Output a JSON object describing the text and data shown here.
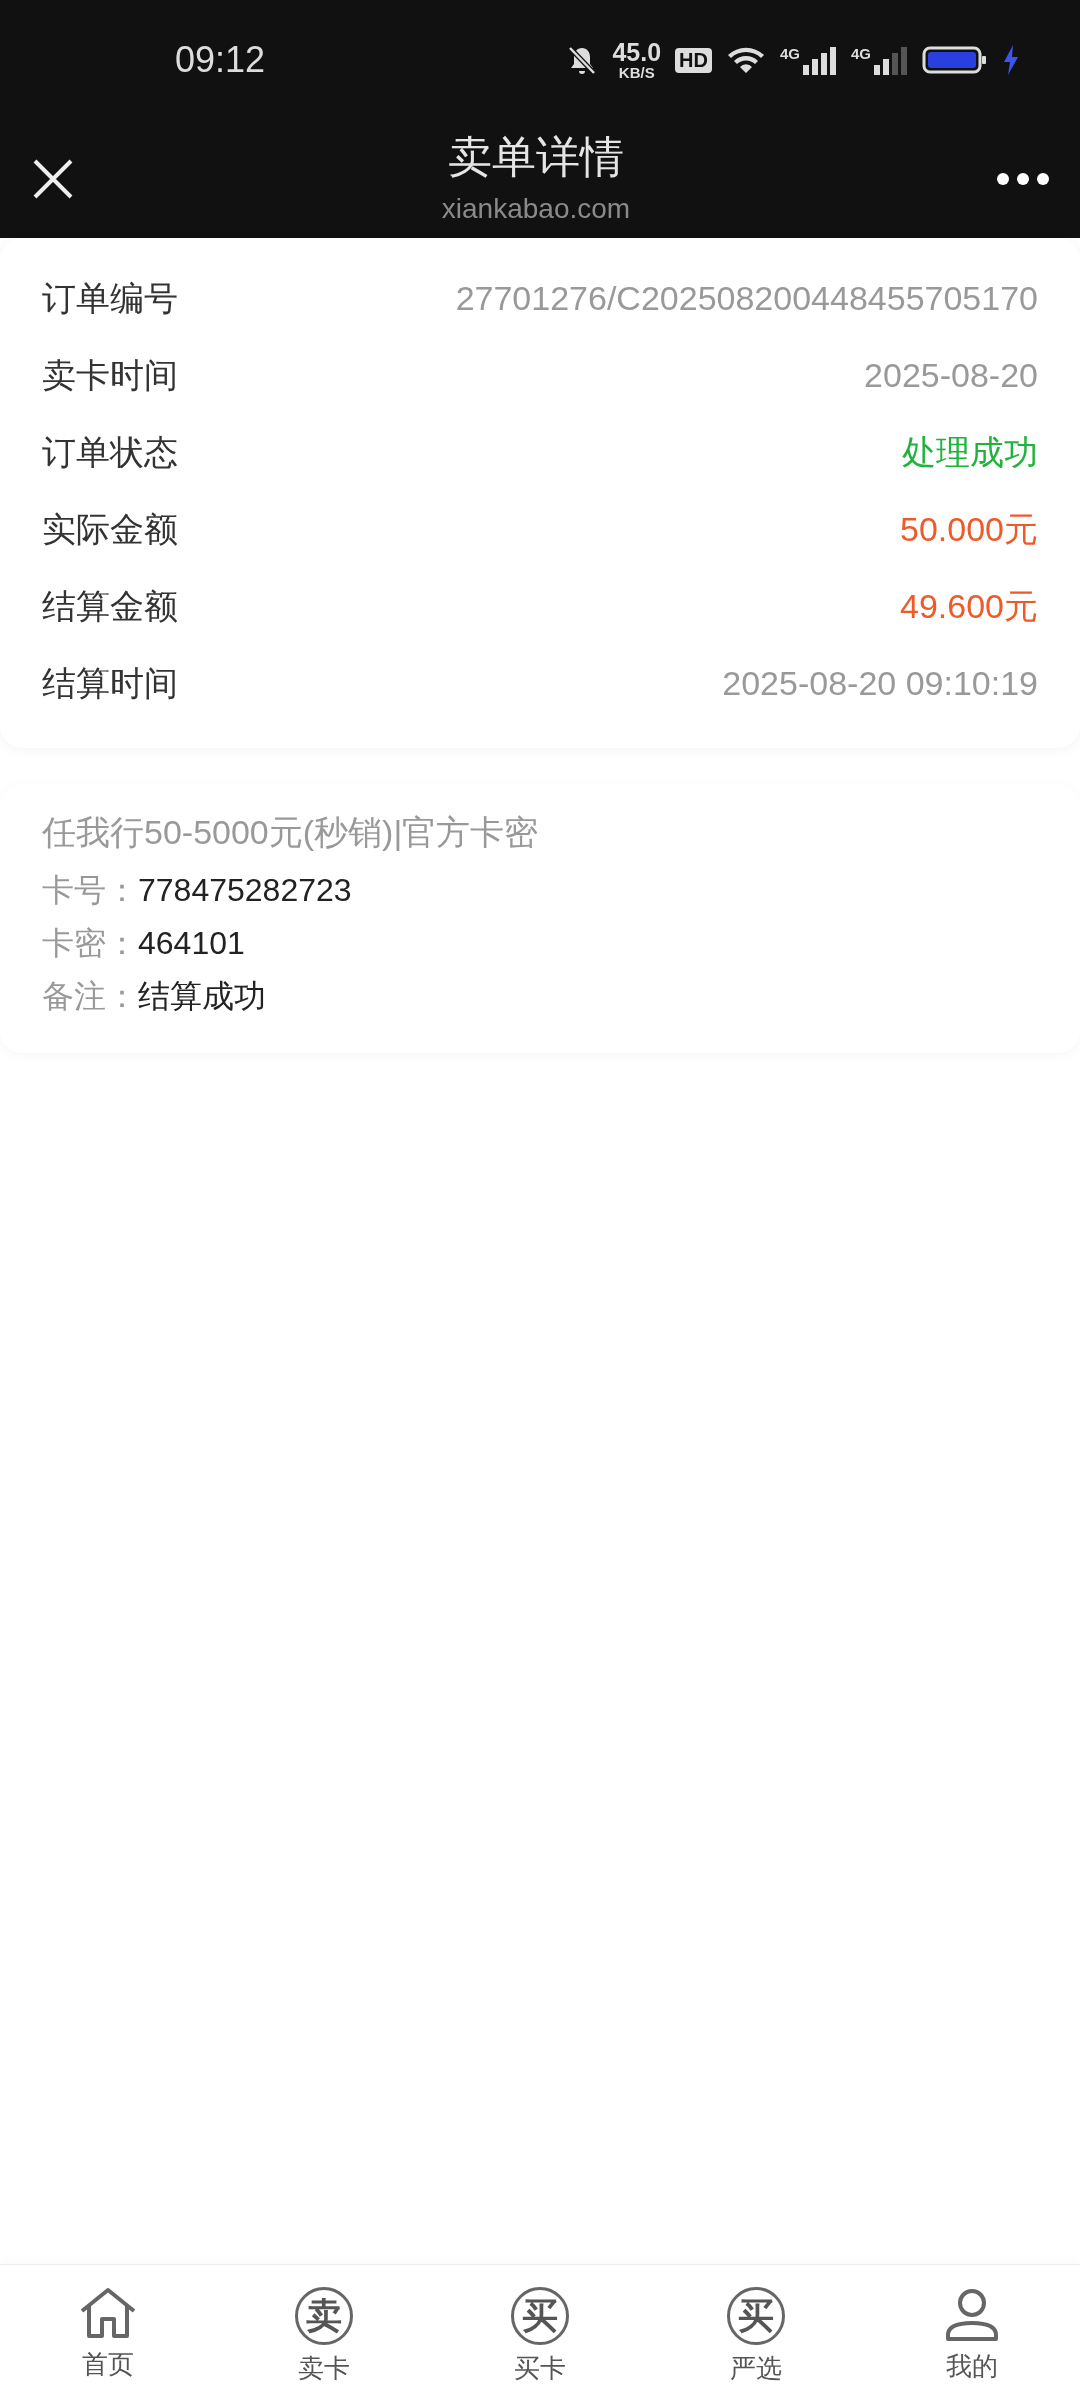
{
  "status_bar": {
    "time": "09:12",
    "net_speed": "45.0",
    "net_unit": "KB/S",
    "hd": "HD",
    "signals": [
      "4G",
      "4G"
    ]
  },
  "header": {
    "title": "卖单详情",
    "subtitle": "xiankabao.com"
  },
  "details": [
    {
      "label": "订单编号",
      "value": "27701276/C202508200448455705170",
      "kind": "plain"
    },
    {
      "label": "卖卡时间",
      "value": "2025-08-20",
      "kind": "plain"
    },
    {
      "label": "订单状态",
      "value": "处理成功",
      "kind": "success"
    },
    {
      "label": "实际金额",
      "value": "50.000元",
      "kind": "amount"
    },
    {
      "label": "结算金额",
      "value": "49.600元",
      "kind": "amount"
    },
    {
      "label": "结算时间",
      "value": "2025-08-20 09:10:19",
      "kind": "plain"
    }
  ],
  "card": {
    "title": "任我行50-5000元(秒销)|官方卡密",
    "fields": [
      {
        "label": "卡号：",
        "value": "778475282723"
      },
      {
        "label": "卡密：",
        "value": "464101"
      },
      {
        "label": "备注：",
        "value": "结算成功"
      }
    ]
  },
  "nav": [
    {
      "label": "首页",
      "kind": "home",
      "selected": false
    },
    {
      "label": "卖卡",
      "kind": "char",
      "glyph": "卖",
      "selected": false
    },
    {
      "label": "买卡",
      "kind": "char",
      "glyph": "买",
      "selected": false
    },
    {
      "label": "严选",
      "kind": "char",
      "glyph": "买",
      "selected": false
    },
    {
      "label": "我的",
      "kind": "user",
      "selected": false
    }
  ]
}
